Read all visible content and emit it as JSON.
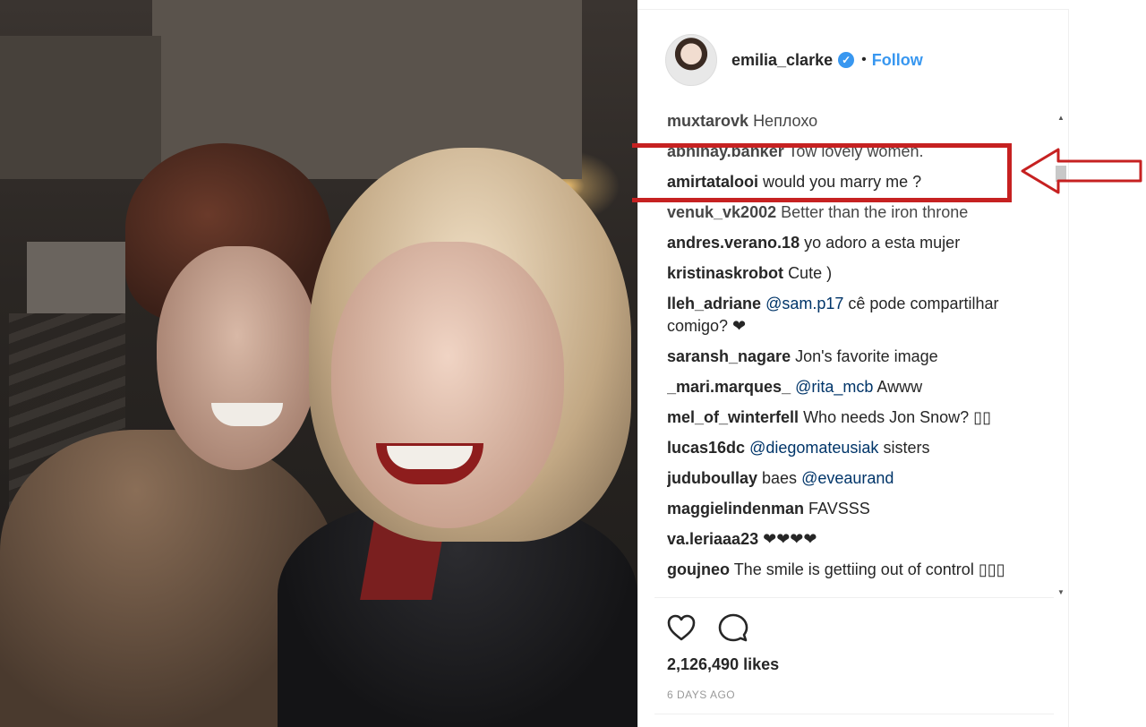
{
  "post": {
    "username": "emilia_clarke",
    "verified_symbol": "✓",
    "separator": "•",
    "follow_label": "Follow",
    "likes": "2,126,490 likes",
    "date": "6 DAYS AGO"
  },
  "comments": [
    {
      "user": "muxtarovk",
      "text": "Неплохо"
    },
    {
      "user": "abhinay.banker",
      "text": "Tow lovely women."
    },
    {
      "user": "amirtatalooi",
      "text": "would you marry me ?"
    },
    {
      "user": "venuk_vk2002",
      "text": "Better than the iron throne"
    },
    {
      "user": "andres.verano.18",
      "text": "yo adoro a esta mujer"
    },
    {
      "user": "kristinaskrobot",
      "text": "Cute )"
    },
    {
      "user": "lleh_adriane",
      "mention": "@sam.p17",
      "text": "cê pode compartilhar comigo? ❤"
    },
    {
      "user": "saransh_nagare",
      "text": "Jon's favorite image"
    },
    {
      "user": "_mari.marques_",
      "mention": "@rita_mcb",
      "text": "Awww"
    },
    {
      "user": "mel_of_winterfell",
      "text": "Who needs Jon Snow? ▯▯"
    },
    {
      "user": "lucas16dc",
      "mention": "@diegomateusiak",
      "text": "sisters"
    },
    {
      "user": "juduboullay",
      "text": "baes",
      "mention_after": "@eveaurand"
    },
    {
      "user": "maggielindenman",
      "text": "FAVSSS"
    },
    {
      "user": "va.leriaaa23",
      "text": "❤❤❤❤"
    },
    {
      "user": "goujneo",
      "text": "The smile is gettiing out of control ▯▯▯"
    }
  ],
  "icons": {
    "like": "heart-icon",
    "comment": "comment-icon",
    "scroll_up": "▲",
    "scroll_down": "▼"
  },
  "colors": {
    "link": "#3897f0",
    "highlight": "#c62121",
    "text": "#262626",
    "muted": "#999999"
  }
}
